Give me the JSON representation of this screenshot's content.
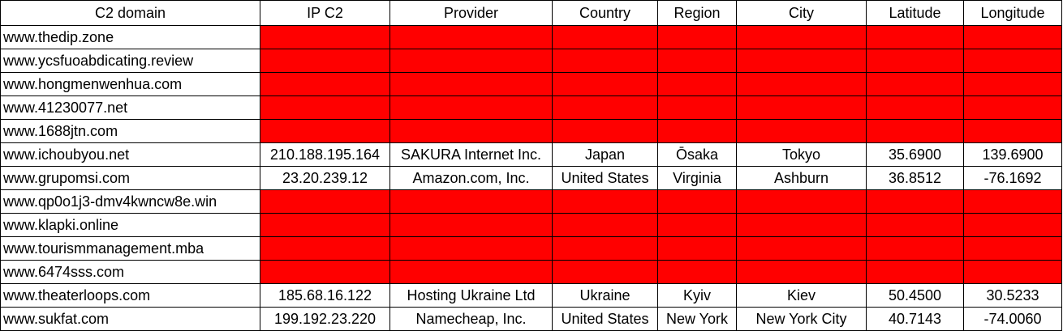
{
  "headers": [
    "C2 domain",
    "IP C2",
    "Provider",
    "Country",
    "Region",
    "City",
    "Latitude",
    "Longitude"
  ],
  "colors": {
    "missing_fill": "#ff0000",
    "grid": "#000000",
    "background": "#ffffff"
  },
  "rows": [
    {
      "domain": "www.thedip.zone",
      "missing": true
    },
    {
      "domain": "www.ycsfuoabdicating.review",
      "missing": true
    },
    {
      "domain": "www.hongmenwenhua.com",
      "missing": true
    },
    {
      "domain": "www.41230077.net",
      "missing": true
    },
    {
      "domain": "www.1688jtn.com",
      "missing": true
    },
    {
      "domain": "www.ichoubyou.net",
      "missing": false,
      "ip": "210.188.195.164",
      "provider": "SAKURA Internet Inc.",
      "country": "Japan",
      "region": "Ōsaka",
      "city": "Tokyo",
      "latitude": "35.6900",
      "longitude": "139.6900"
    },
    {
      "domain": "www.grupomsi.com",
      "missing": false,
      "ip": "23.20.239.12",
      "provider": "Amazon.com, Inc.",
      "country": "United States",
      "region": "Virginia",
      "city": "Ashburn",
      "latitude": "36.8512",
      "longitude": "-76.1692"
    },
    {
      "domain": "www.qp0o1j3-dmv4kwncw8e.win",
      "missing": true
    },
    {
      "domain": "www.klapki.online",
      "missing": true
    },
    {
      "domain": "www.tourismmanagement.mba",
      "missing": true
    },
    {
      "domain": "www.6474sss.com",
      "missing": true
    },
    {
      "domain": "www.theaterloops.com",
      "missing": false,
      "ip": "185.68.16.122",
      "provider": "Hosting Ukraine Ltd",
      "country": "Ukraine",
      "region": "Kyiv",
      "city": "Kiev",
      "latitude": "50.4500",
      "longitude": "30.5233"
    },
    {
      "domain": "www.sukfat.com",
      "missing": false,
      "ip": "199.192.23.220",
      "provider": "Namecheap, Inc.",
      "country": "United States",
      "region": "New York",
      "city": "New York City",
      "latitude": "40.7143",
      "longitude": "-74.0060"
    }
  ]
}
